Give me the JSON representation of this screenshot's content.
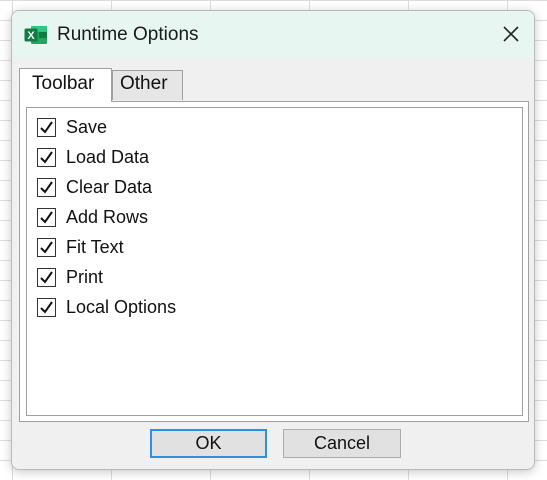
{
  "window": {
    "title": "Runtime Options",
    "icon": "excel-icon",
    "icon_letter": "X",
    "accent": "#107c41",
    "close_icon": "close-icon"
  },
  "tabs": [
    {
      "label": "Toolbar",
      "active": true
    },
    {
      "label": "Other",
      "active": false
    }
  ],
  "options": [
    {
      "label": "Save",
      "checked": true
    },
    {
      "label": "Load Data",
      "checked": true
    },
    {
      "label": "Clear Data",
      "checked": true
    },
    {
      "label": "Add Rows",
      "checked": true
    },
    {
      "label": "Fit Text",
      "checked": true
    },
    {
      "label": "Print",
      "checked": true
    },
    {
      "label": "Local Options",
      "checked": true
    }
  ],
  "buttons": {
    "ok_label": "OK",
    "cancel_label": "Cancel"
  }
}
